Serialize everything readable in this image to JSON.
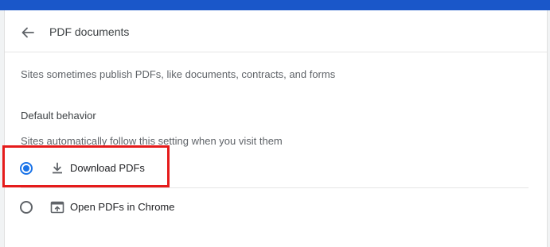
{
  "header": {
    "title": "PDF documents",
    "back_icon": "arrow-back-icon"
  },
  "description": "Sites sometimes publish PDFs, like documents, contracts, and forms",
  "default_behavior": {
    "heading": "Default behavior",
    "subtext": "Sites automatically follow this setting when you visit them",
    "options": [
      {
        "label": "Download PDFs",
        "icon": "download-icon",
        "selected": true
      },
      {
        "label": "Open PDFs in Chrome",
        "icon": "open-in-browser-icon",
        "selected": false
      }
    ]
  },
  "colors": {
    "top_bar": "#1a57c9",
    "accent": "#1a73e8",
    "highlight": "#e51b1b"
  }
}
